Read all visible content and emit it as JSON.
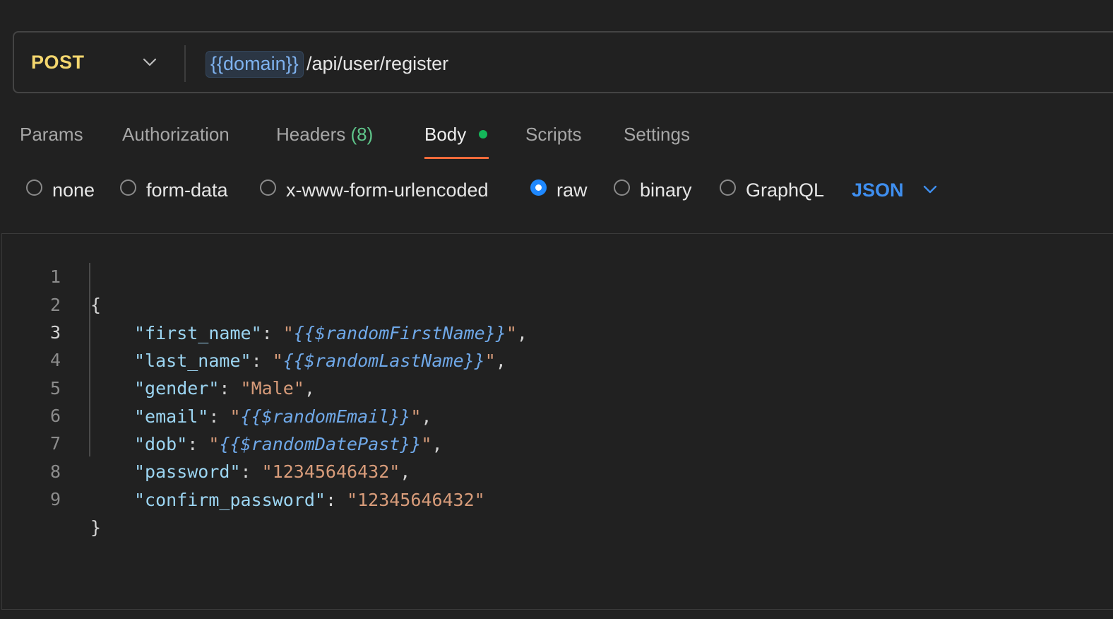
{
  "request": {
    "method": "POST",
    "url_variable": "{{domain}}",
    "url_path": "/api/user/register"
  },
  "tabs": [
    {
      "label": "Params"
    },
    {
      "label": "Authorization"
    },
    {
      "label": "Headers",
      "count": "(8)"
    },
    {
      "label": "Body",
      "active": true
    },
    {
      "label": "Scripts"
    },
    {
      "label": "Settings"
    }
  ],
  "body_types": [
    {
      "label": "none",
      "selected": false
    },
    {
      "label": "form-data",
      "selected": false
    },
    {
      "label": "x-www-form-urlencoded",
      "selected": false
    },
    {
      "label": "raw",
      "selected": true
    },
    {
      "label": "binary",
      "selected": false
    },
    {
      "label": "GraphQL",
      "selected": false
    }
  ],
  "language": "JSON",
  "colors": {
    "method": "#f5d76e",
    "accent": "#f26b3a",
    "radio_selected": "#1e88ff",
    "language": "#3f8ff0",
    "tab_dot": "#14b85a"
  },
  "editor": {
    "line_numbers": [
      "1",
      "2",
      "3",
      "4",
      "5",
      "6",
      "7",
      "8",
      "9"
    ],
    "lines": [
      {
        "open": "{"
      },
      {
        "key": "\"first_name\"",
        "sep": ": ",
        "q1": "\"",
        "var": "{{$randomFirstName}}",
        "q2": "\"",
        "end": ","
      },
      {
        "key": "\"last_name\"",
        "sep": ": ",
        "q1": "\"",
        "var": "{{$randomLastName}}",
        "q2": "\"",
        "end": ","
      },
      {
        "key": "\"gender\"",
        "sep": ": ",
        "str": "\"Male\"",
        "end": ","
      },
      {
        "key": "\"email\"",
        "sep": ": ",
        "q1": "\"",
        "var": "{{$randomEmail}}",
        "q2": "\"",
        "end": ","
      },
      {
        "key": "\"dob\"",
        "sep": ": ",
        "q1": "\"",
        "var": "{{$randomDatePast}}",
        "q2": "\"",
        "end": ","
      },
      {
        "key": "\"password\"",
        "sep": ": ",
        "str": "\"12345646432\"",
        "end": ","
      },
      {
        "key": "\"confirm_password\"",
        "sep": ": ",
        "str": "\"12345646432\"",
        "end": ""
      },
      {
        "close": "}"
      }
    ]
  }
}
